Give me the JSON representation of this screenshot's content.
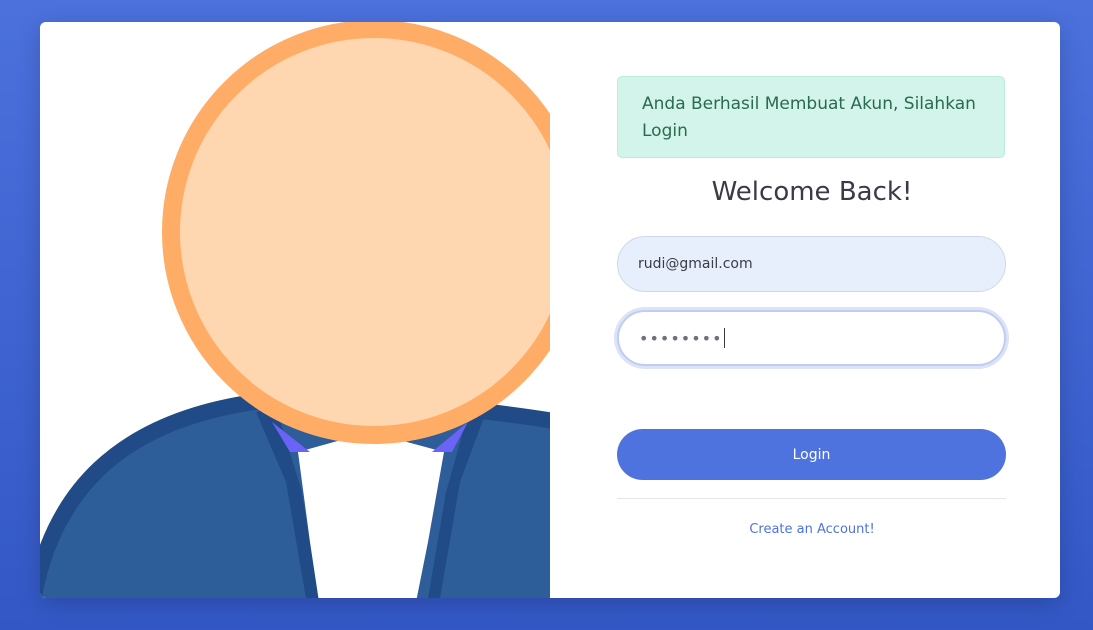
{
  "alert": {
    "message": "Anda Berhasil Membuat Akun, Silahkan Login"
  },
  "form": {
    "title": "Welcome Back!",
    "email_value": "rudi@gmail.com",
    "password_masked": "••••••••",
    "login_label": "Login",
    "create_account_label": "Create an Account!"
  },
  "illustration": {
    "icon": "user-avatar-icon"
  },
  "colors": {
    "background": "#4c71dd",
    "primary": "#4e73df",
    "alert_bg": "#d2f4ea",
    "alert_text": "#2b6a4e",
    "face": "#fed7b1",
    "face_outline": "#ffad66",
    "suit": "#2e5e9a"
  }
}
